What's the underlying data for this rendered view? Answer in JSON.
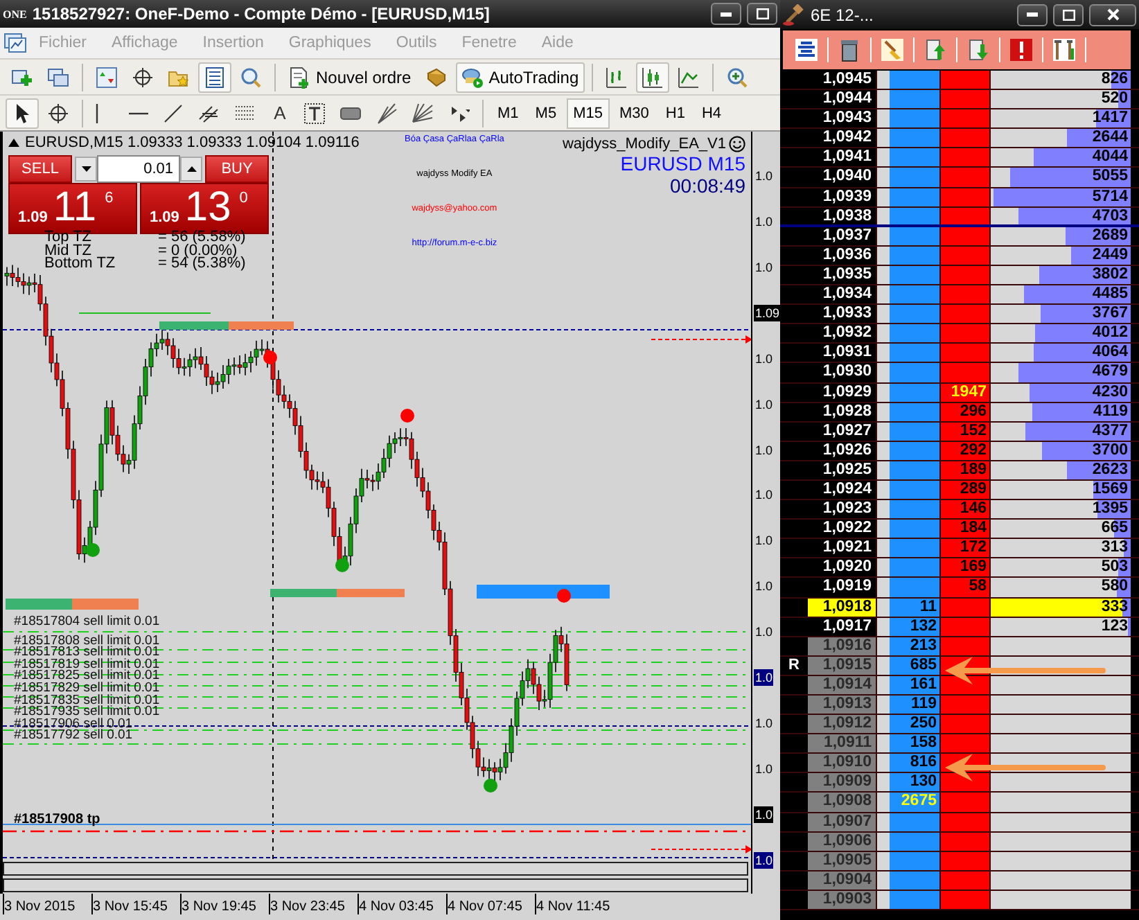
{
  "window": {
    "logo": "ONE",
    "title": "1518527927: OneF-Demo - Compte Démo - [EURUSD,M15]"
  },
  "menu": [
    {
      "label": "Fichier",
      "disabled": true
    },
    {
      "label": "Affichage",
      "disabled": true
    },
    {
      "label": "Insertion",
      "disabled": true
    },
    {
      "label": "Graphiques",
      "disabled": true
    },
    {
      "label": "Outils",
      "disabled": true
    },
    {
      "label": "Fenetre",
      "disabled": true
    },
    {
      "label": "Aide",
      "disabled": true
    }
  ],
  "main_toolbar": {
    "groups": [
      {
        "items": [
          {
            "kind": "new-chart",
            "selected": false
          },
          {
            "kind": "profiles",
            "selected": false
          }
        ]
      },
      {
        "items": [
          {
            "kind": "market-watch",
            "selected": false
          },
          {
            "kind": "navigator",
            "selected": false
          },
          {
            "kind": "favorites",
            "selected": false
          },
          {
            "kind": "data-window",
            "selected": true
          },
          {
            "kind": "tester",
            "selected": false
          }
        ]
      },
      {
        "items": [
          {
            "kind": "new-order",
            "label": "Nouvel ordre",
            "selected": false
          },
          {
            "kind": "editor",
            "selected": false
          },
          {
            "kind": "autotrading",
            "label": "AutoTrading",
            "selected": true
          }
        ]
      },
      {
        "items": [
          {
            "kind": "bars",
            "selected": false
          },
          {
            "kind": "candles",
            "selected": true
          },
          {
            "kind": "line",
            "selected": false
          }
        ]
      },
      {
        "items": [
          {
            "kind": "zoom",
            "selected": false
          }
        ]
      }
    ]
  },
  "drawing_toolbar": {
    "groups": [
      {
        "items": [
          {
            "kind": "cursor",
            "selected": true
          },
          {
            "kind": "crosshair",
            "selected": false
          }
        ]
      },
      {
        "items": [
          {
            "kind": "vline",
            "selected": false
          },
          {
            "kind": "hline",
            "selected": false
          },
          {
            "kind": "trendline",
            "selected": false
          },
          {
            "kind": "channel",
            "selected": false
          },
          {
            "kind": "fibo",
            "selected": false
          },
          {
            "kind": "text",
            "label": "A",
            "selected": false
          },
          {
            "kind": "label",
            "selected": false
          },
          {
            "kind": "rectangle",
            "selected": false
          },
          {
            "kind": "fibfan",
            "selected": false
          },
          {
            "kind": "gannfan",
            "selected": false
          },
          {
            "kind": "arrows",
            "selected": false
          }
        ]
      }
    ]
  },
  "timeframes": [
    {
      "label": "M1",
      "selected": false
    },
    {
      "label": "M5",
      "selected": false
    },
    {
      "label": "M15",
      "selected": true
    },
    {
      "label": "M30",
      "selected": false
    },
    {
      "label": "H1",
      "selected": false
    },
    {
      "label": "H4",
      "selected": false
    }
  ],
  "chart": {
    "symbol_line": "EURUSD,M15 1.09333 1.09333 1.09104 1.09116",
    "one_click": {
      "sell": "SELL",
      "buy": "BUY",
      "lot": "0.01",
      "bid": {
        "prefix": "1.09",
        "big": "11",
        "small": "6"
      },
      "ask": {
        "prefix": "1.09",
        "big": "13",
        "small": "0"
      }
    },
    "indicator_rows": [
      {
        "label": "Top TZ",
        "value": "= 56 (5.58%)"
      },
      {
        "label": "Mid TZ",
        "value": "= 0 (0.00%)"
      },
      {
        "label": "Bottom TZ",
        "value": "= 54 (5.38%)"
      }
    ],
    "ea_name": "wajdyss_Modify_EA_V1",
    "ea_symbol": "EURUSD  M15",
    "countdown": "00:08:49",
    "credits": [
      {
        "text": "Bóa Çasa ÇaRlaa ÇaRla",
        "color": "#0000ff"
      },
      {
        "text": "wajdyss Modify EA",
        "color": "#000000"
      },
      {
        "text": "wajdyss@yahoo.com",
        "color": "#ff0000"
      },
      {
        "text": "http://forum.m-e-c.biz",
        "color": "#0000ff"
      }
    ],
    "order_labels": [
      "#18517804 sell limit 0.01",
      "#18517808 sell limit 0.01",
      "#18517813 sell limit 0.01",
      "#18517819 sell limit 0.01",
      "#18517825 sell limit 0.01",
      "#18517829 sell limit 0.01",
      "#18517835 sell limit 0.01",
      "#18517935 sell limit 0.01",
      "#18517906 sell 0.01",
      "#18517792 sell 0.01"
    ],
    "tp_label": "#18517908 tp",
    "price_axis": [
      {
        "text": "1.0",
        "kind": "plain"
      },
      {
        "text": "1.0",
        "kind": "plain"
      },
      {
        "text": "1.0",
        "kind": "plain"
      },
      {
        "text": "1.09",
        "kind": "bid"
      },
      {
        "text": "1.0",
        "kind": "plain"
      },
      {
        "text": "1.0",
        "kind": "plain"
      },
      {
        "text": "1.0",
        "kind": "plain"
      },
      {
        "text": "1.0",
        "kind": "plain"
      },
      {
        "text": "1.0",
        "kind": "plain"
      },
      {
        "text": "1.0",
        "kind": "plain"
      },
      {
        "text": "1.0",
        "kind": "plain"
      },
      {
        "text": "1.0",
        "kind": "line"
      },
      {
        "text": "1.0",
        "kind": "plain"
      },
      {
        "text": "1.0",
        "kind": "plain"
      },
      {
        "text": "1.0",
        "kind": "bid"
      },
      {
        "text": "1.0",
        "kind": "line"
      }
    ],
    "time_axis": [
      "3 Nov 2015",
      "3 Nov 15:45",
      "3 Nov 19:45",
      "3 Nov 23:45",
      "4 Nov 03:45",
      "4 Nov 07:45",
      "4 Nov 11:45"
    ]
  },
  "dom": {
    "title": "6E 12-...",
    "rows": [
      {
        "price": "1,0945",
        "kind": "ask",
        "volume": "826",
        "level": 0.14
      },
      {
        "price": "1,0944",
        "kind": "ask",
        "volume": "520",
        "level": 0.09
      },
      {
        "price": "1,0943",
        "kind": "ask",
        "volume": "1417",
        "level": 0.25
      },
      {
        "price": "1,0942",
        "kind": "ask",
        "volume": "2644",
        "level": 0.46
      },
      {
        "price": "1,0941",
        "kind": "ask",
        "volume": "4044",
        "level": 0.71
      },
      {
        "price": "1,0940",
        "kind": "ask",
        "volume": "5055",
        "level": 0.88
      },
      {
        "price": "1,0939",
        "kind": "ask",
        "volume": "5714",
        "level": 1
      },
      {
        "price": "1,0938",
        "kind": "ask",
        "volume": "4703",
        "level": 0.82,
        "separator_below": true
      },
      {
        "price": "1,0937",
        "kind": "ask",
        "volume": "2689",
        "level": 0.47
      },
      {
        "price": "1,0936",
        "kind": "ask",
        "volume": "2449",
        "level": 0.43
      },
      {
        "price": "1,0935",
        "kind": "ask",
        "volume": "3802",
        "level": 0.67
      },
      {
        "price": "1,0934",
        "kind": "ask",
        "volume": "4485",
        "level": 0.78
      },
      {
        "price": "1,0933",
        "kind": "ask",
        "volume": "3767",
        "level": 0.66
      },
      {
        "price": "1,0932",
        "kind": "ask",
        "volume": "4012",
        "level": 0.7
      },
      {
        "price": "1,0931",
        "kind": "ask",
        "volume": "4064",
        "level": 0.71
      },
      {
        "price": "1,0930",
        "kind": "ask",
        "volume": "4679",
        "level": 0.82
      },
      {
        "price": "1,0929",
        "kind": "ask",
        "ask": "1947",
        "highlight": true,
        "volume": "4230",
        "level": 0.74
      },
      {
        "price": "1,0928",
        "kind": "ask",
        "ask": "296",
        "volume": "4119",
        "level": 0.72
      },
      {
        "price": "1,0927",
        "kind": "ask",
        "ask": "152",
        "volume": "4377",
        "level": 0.77
      },
      {
        "price": "1,0926",
        "kind": "ask",
        "ask": "292",
        "volume": "3700",
        "level": 0.65
      },
      {
        "price": "1,0925",
        "kind": "ask",
        "ask": "189",
        "volume": "2623",
        "level": 0.46
      },
      {
        "price": "1,0924",
        "kind": "ask",
        "ask": "289",
        "volume": "1569",
        "level": 0.27
      },
      {
        "price": "1,0923",
        "kind": "ask",
        "ask": "146",
        "volume": "1395",
        "level": 0.24
      },
      {
        "price": "1,0922",
        "kind": "ask",
        "ask": "184",
        "volume": "665",
        "level": 0.12
      },
      {
        "price": "1,0921",
        "kind": "ask",
        "ask": "172",
        "volume": "313",
        "level": 0.05
      },
      {
        "price": "1,0920",
        "kind": "ask",
        "ask": "169",
        "volume": "503",
        "level": 0.09
      },
      {
        "price": "1,0919",
        "kind": "ask",
        "ask": "58",
        "volume": "580",
        "level": 0.1
      },
      {
        "price": "1,0918",
        "kind": "last",
        "bid": "11",
        "volume": "333",
        "level": 0.06
      },
      {
        "price": "1,0917",
        "kind": "ask",
        "bid": "132",
        "volume": "123",
        "level": 0.02
      },
      {
        "price": "1,0916",
        "kind": "bid",
        "bid": "213"
      },
      {
        "price": "1,0915",
        "kind": "bid",
        "bid": "685",
        "marker": "R"
      },
      {
        "price": "1,0914",
        "kind": "bid",
        "bid": "161"
      },
      {
        "price": "1,0913",
        "kind": "bid",
        "bid": "119"
      },
      {
        "price": "1,0912",
        "kind": "bid",
        "bid": "250"
      },
      {
        "price": "1,0911",
        "kind": "bid",
        "bid": "158"
      },
      {
        "price": "1,0910",
        "kind": "bid",
        "bid": "816"
      },
      {
        "price": "1,0909",
        "kind": "bid",
        "bid": "130"
      },
      {
        "price": "1,0908",
        "kind": "bid",
        "bid": "2675",
        "highlight": true
      },
      {
        "price": "1,0907",
        "kind": "bid"
      },
      {
        "price": "1,0906",
        "kind": "bid"
      },
      {
        "price": "1,0905",
        "kind": "bid"
      },
      {
        "price": "1,0904",
        "kind": "bid"
      },
      {
        "price": "1,0903",
        "kind": "bid"
      }
    ]
  }
}
